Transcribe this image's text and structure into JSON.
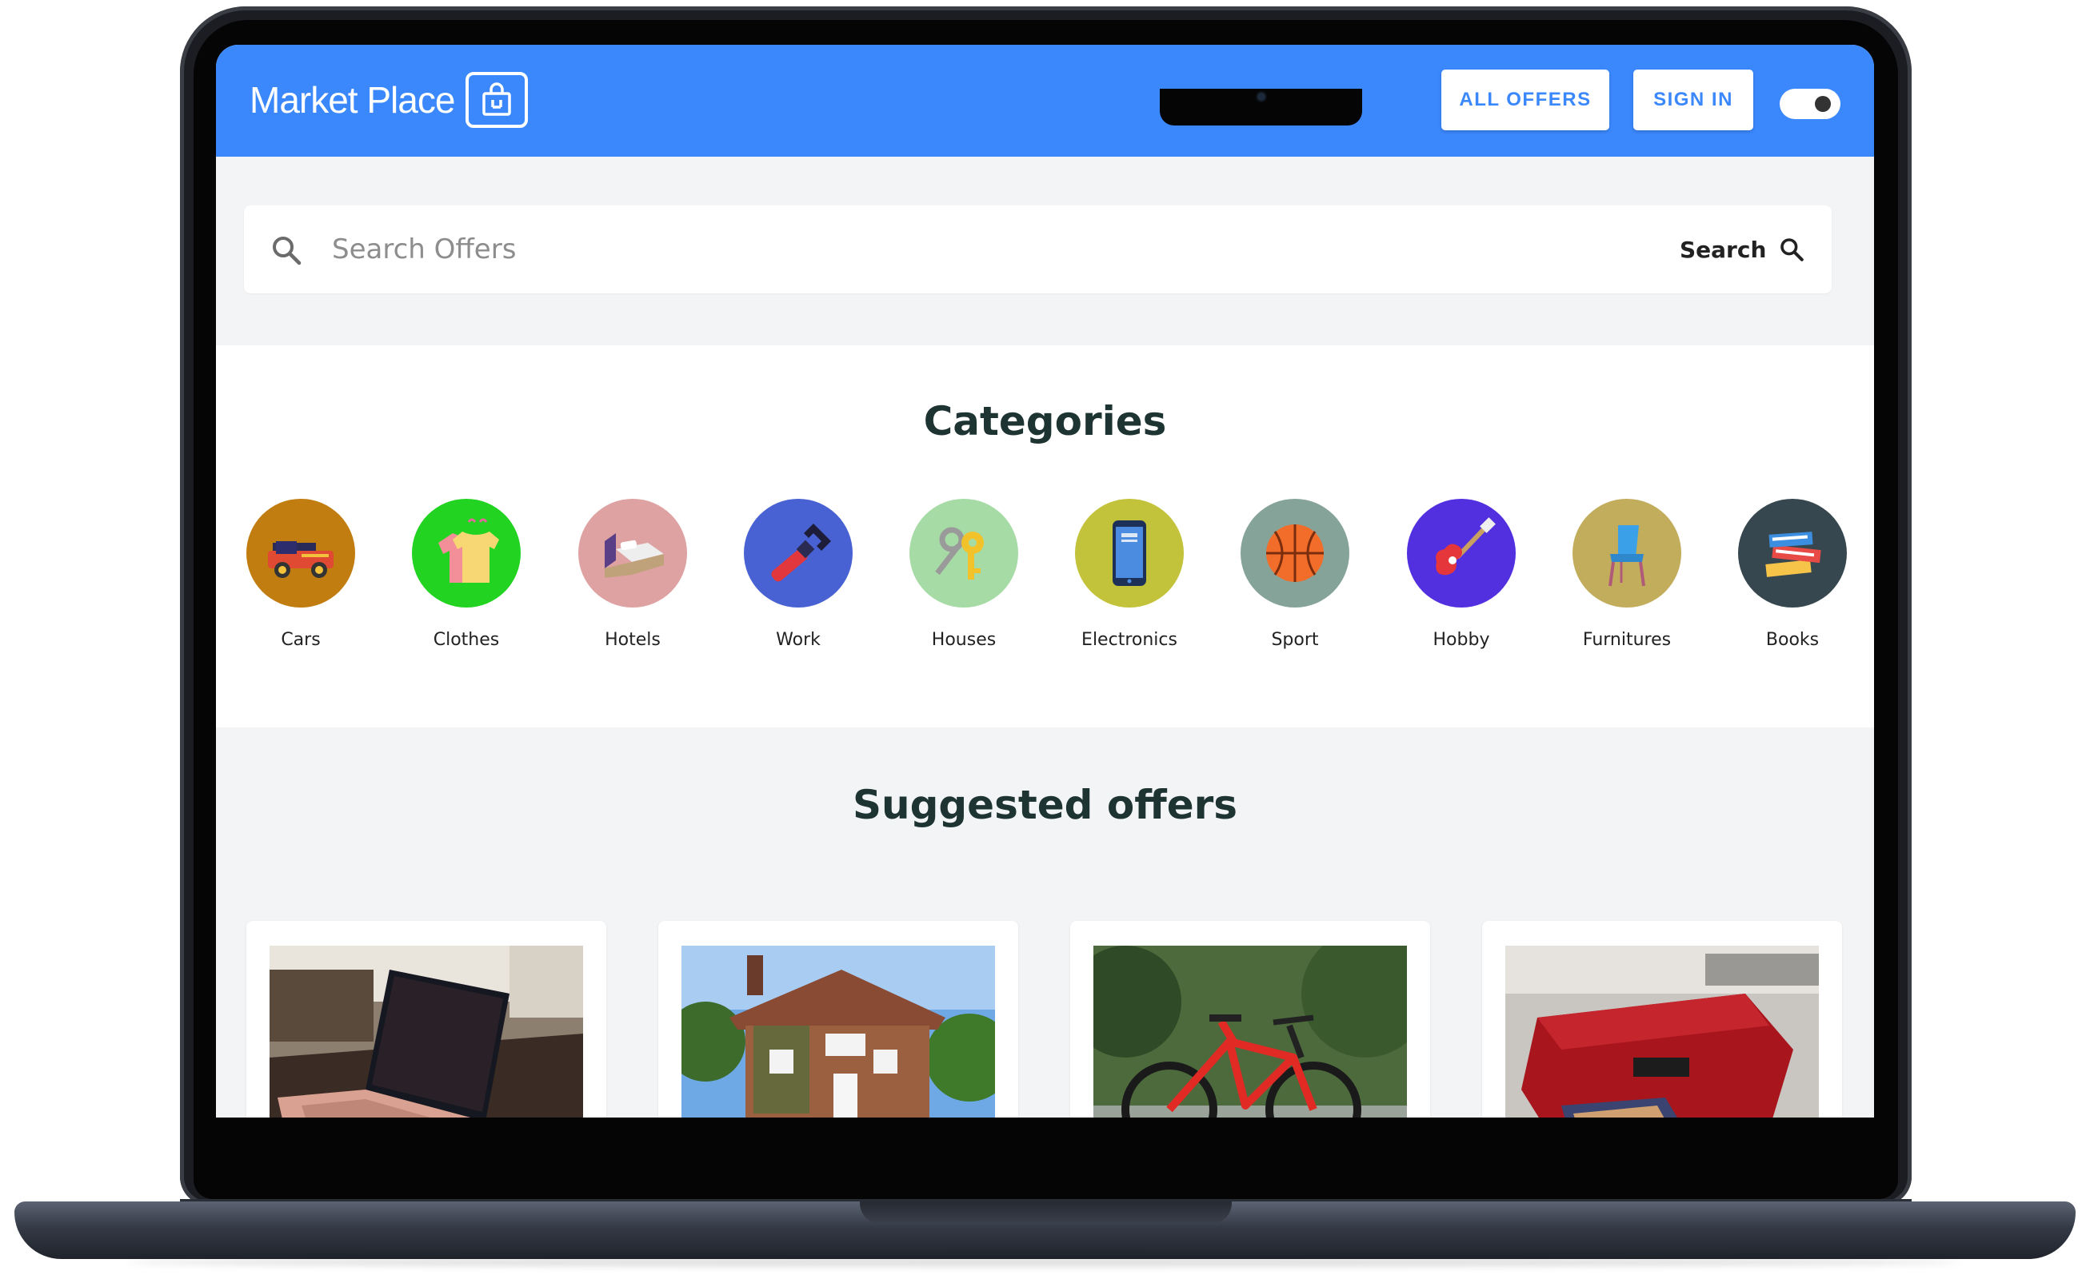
{
  "header": {
    "brand": "Market Place",
    "nav": {
      "all_offers": "ALL OFFERS",
      "sign_in": "SIGN IN"
    },
    "accent_color": "#3b88fd"
  },
  "search": {
    "placeholder": "Search Offers",
    "button_label": "Search"
  },
  "categories": {
    "title": "Categories",
    "items": [
      {
        "label": "Cars",
        "icon": "car-icon",
        "color": "#c17d0f"
      },
      {
        "label": "Clothes",
        "icon": "clothes-icon",
        "color": "#22d322"
      },
      {
        "label": "Hotels",
        "icon": "bed-icon",
        "color": "#dea2a2"
      },
      {
        "label": "Work",
        "icon": "wrench-icon",
        "color": "#4962d3"
      },
      {
        "label": "Houses",
        "icon": "keys-icon",
        "color": "#a6dba6"
      },
      {
        "label": "Electronics",
        "icon": "phone-icon",
        "color": "#c2c33a"
      },
      {
        "label": "Sport",
        "icon": "basketball-icon",
        "color": "#86a39a"
      },
      {
        "label": "Hobby",
        "icon": "guitar-icon",
        "color": "#5330df"
      },
      {
        "label": "Furnitures",
        "icon": "chair-icon",
        "color": "#c2ad5c"
      },
      {
        "label": "Books",
        "icon": "books-icon",
        "color": "#37474f"
      }
    ]
  },
  "offers": {
    "title": "Suggested offers",
    "items": [
      {
        "image": "laptop-photo"
      },
      {
        "image": "house-photo"
      },
      {
        "image": "bicycle-photo"
      },
      {
        "image": "printer-photo"
      }
    ]
  }
}
